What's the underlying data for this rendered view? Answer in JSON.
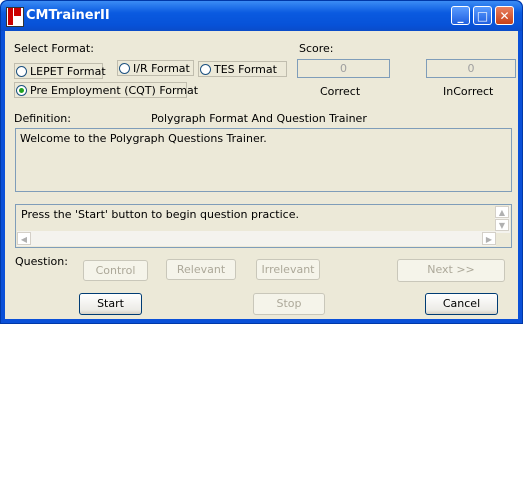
{
  "window": {
    "title": "CMTrainerII"
  },
  "format": {
    "label": "Select Format:",
    "options": [
      {
        "label": "LEPET Format",
        "checked": false
      },
      {
        "label": "I/R Format",
        "checked": false
      },
      {
        "label": "TES Format",
        "checked": false
      },
      {
        "label": "Pre Employment (CQT)  Format",
        "checked": true
      }
    ]
  },
  "score": {
    "label": "Score:",
    "correct_value": "0",
    "correct_label": "Correct",
    "incorrect_value": "0",
    "incorrect_label": "InCorrect"
  },
  "definition": {
    "label": "Definition:",
    "heading": "Polygraph Format And Question Trainer",
    "text": "Welcome to the Polygraph Questions Trainer."
  },
  "message": {
    "text": "Press the  'Start' button to begin question practice."
  },
  "question": {
    "label": "Question:",
    "control": "Control",
    "relevant": "Relevant",
    "irrelevant": "Irrelevant",
    "next": "Next >>"
  },
  "actions": {
    "start": "Start",
    "stop": "Stop",
    "cancel": "Cancel"
  }
}
